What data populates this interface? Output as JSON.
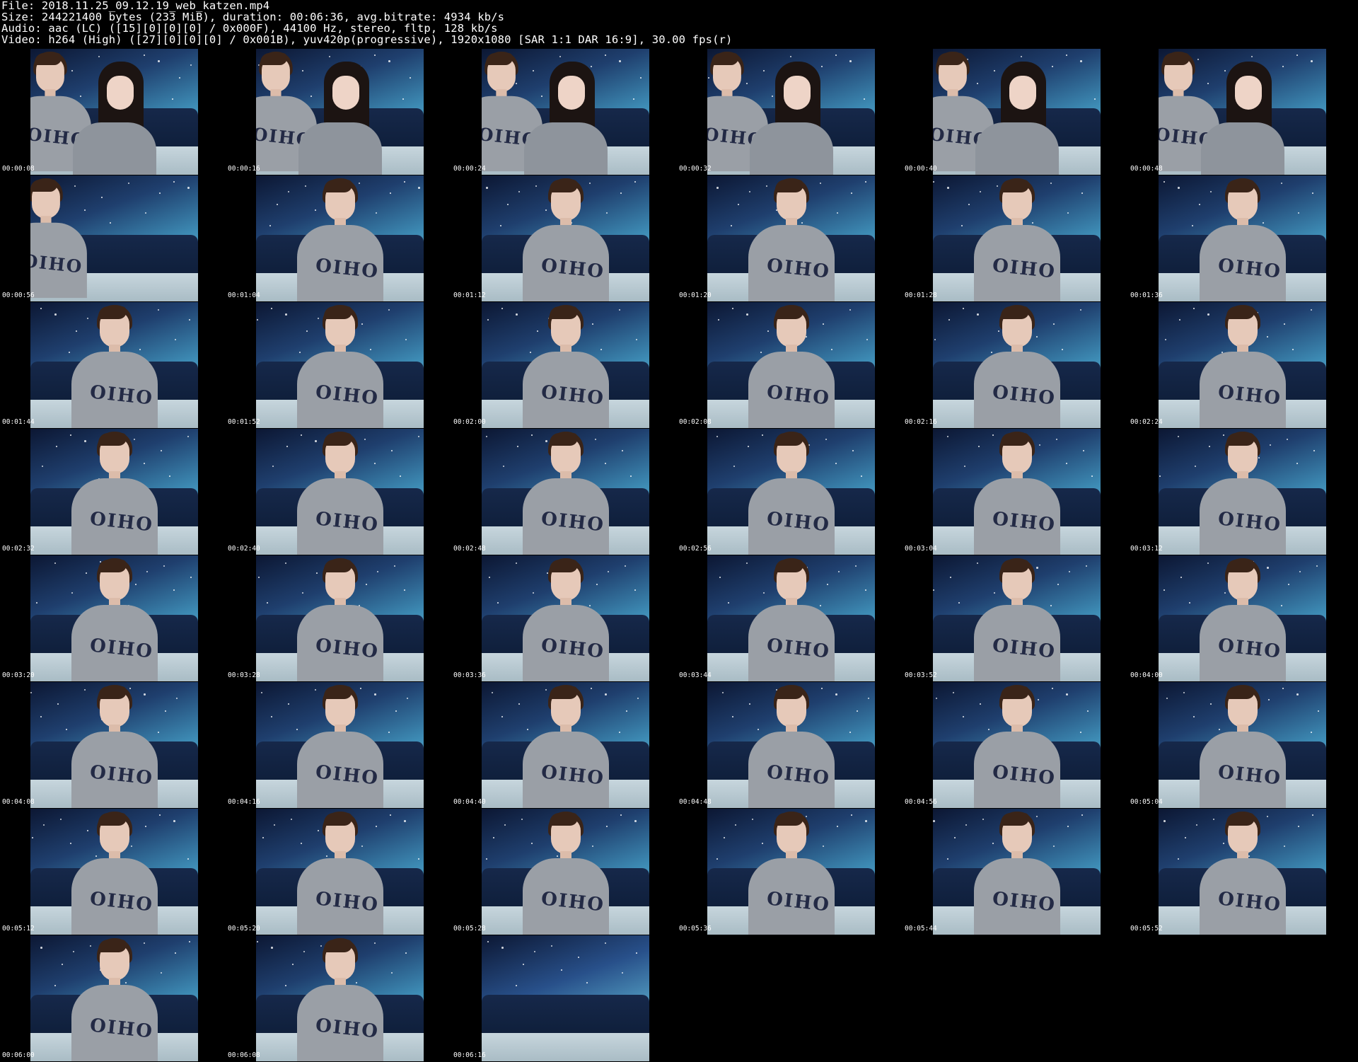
{
  "header": {
    "file_line": "File: 2018.11.25_09.12.19_web_katzen.mp4",
    "size_line": "Size: 244221400 bytes (233 MiB), duration: 00:06:36, avg.bitrate: 4934 kb/s",
    "audio_line": "Audio: aac (LC) ([15][0][0][0] / 0x000F), 44100 Hz, stereo, fltp, 128 kb/s",
    "video_line": "Video: h264 (High) ([27][0][0][0] / 0x001B), yuv420p(progressive), 1920x1080 [SAR 1:1 DAR 16:9], 30.00 fps(r)"
  },
  "thumbnails": [
    {
      "time": "00:00:08",
      "scene": "couple"
    },
    {
      "time": "00:00:16",
      "scene": "couple"
    },
    {
      "time": "00:00:24",
      "scene": "couple"
    },
    {
      "time": "00:00:32",
      "scene": "couple"
    },
    {
      "time": "00:00:40",
      "scene": "couple"
    },
    {
      "time": "00:00:48",
      "scene": "couple"
    },
    {
      "time": "00:00:56",
      "scene": "side"
    },
    {
      "time": "00:01:04",
      "scene": "person"
    },
    {
      "time": "00:01:12",
      "scene": "person"
    },
    {
      "time": "00:01:20",
      "scene": "person"
    },
    {
      "time": "00:01:28",
      "scene": "person"
    },
    {
      "time": "00:01:36",
      "scene": "person"
    },
    {
      "time": "00:01:44",
      "scene": "person"
    },
    {
      "time": "00:01:52",
      "scene": "person"
    },
    {
      "time": "00:02:00",
      "scene": "person"
    },
    {
      "time": "00:02:08",
      "scene": "person"
    },
    {
      "time": "00:02:16",
      "scene": "person"
    },
    {
      "time": "00:02:24",
      "scene": "person"
    },
    {
      "time": "00:02:32",
      "scene": "person"
    },
    {
      "time": "00:02:40",
      "scene": "person"
    },
    {
      "time": "00:02:48",
      "scene": "person"
    },
    {
      "time": "00:02:56",
      "scene": "person"
    },
    {
      "time": "00:03:04",
      "scene": "person"
    },
    {
      "time": "00:03:12",
      "scene": "person"
    },
    {
      "time": "00:03:20",
      "scene": "person"
    },
    {
      "time": "00:03:28",
      "scene": "person"
    },
    {
      "time": "00:03:36",
      "scene": "person"
    },
    {
      "time": "00:03:44",
      "scene": "person"
    },
    {
      "time": "00:03:52",
      "scene": "person"
    },
    {
      "time": "00:04:00",
      "scene": "person"
    },
    {
      "time": "00:04:08",
      "scene": "person"
    },
    {
      "time": "00:04:16",
      "scene": "person"
    },
    {
      "time": "00:04:40",
      "scene": "person"
    },
    {
      "time": "00:04:48",
      "scene": "person"
    },
    {
      "time": "00:04:56",
      "scene": "person"
    },
    {
      "time": "00:05:04",
      "scene": "person"
    },
    {
      "time": "00:05:12",
      "scene": "person"
    },
    {
      "time": "00:05:20",
      "scene": "person"
    },
    {
      "time": "00:05:28",
      "scene": "person"
    },
    {
      "time": "00:05:36",
      "scene": "person"
    },
    {
      "time": "00:05:44",
      "scene": "person"
    },
    {
      "time": "00:05:52",
      "scene": "person"
    },
    {
      "time": "00:06:00",
      "scene": "person"
    },
    {
      "time": "00:06:08",
      "scene": "person"
    },
    {
      "time": "00:06:16",
      "scene": "empty"
    }
  ],
  "shirt_text": "OIHO",
  "colors": {
    "background": "#000000",
    "text": "#ffffff",
    "sky_dark": "#0c1733",
    "sky_light": "#7fd0e4",
    "couch": "#16284a",
    "shirt": "#9a9fa6",
    "shirt_print": "#232a45"
  }
}
